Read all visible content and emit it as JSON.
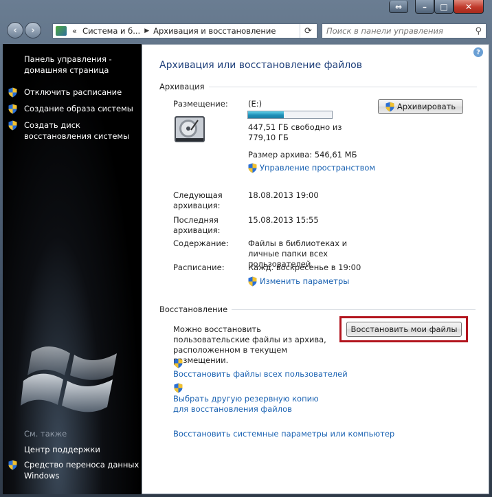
{
  "window": {
    "buttons": {
      "resize": "⇔",
      "minimize": "–",
      "maximize": "□",
      "close": "✕"
    }
  },
  "nav": {
    "back_icon": "back-arrow-icon",
    "forward_icon": "forward-arrow-icon",
    "address": {
      "prefix": "«",
      "seg1": "Система и б...",
      "seg2": "Архивация и восстановление"
    },
    "search_placeholder": "Поиск в панели управления"
  },
  "sidebar": {
    "home": "Панель управления - домашняя страница",
    "tasks": [
      {
        "label": "Отключить расписание"
      },
      {
        "label": "Создание образа системы"
      },
      {
        "label": "Создать диск восстановления системы"
      }
    ],
    "see_also": "См. также",
    "links": [
      {
        "label": "Центр поддержки"
      },
      {
        "label": "Средство переноса данных Windows"
      }
    ]
  },
  "main": {
    "title": "Архивация или восстановление файлов",
    "backup": {
      "header": "Архивация",
      "location_label": "Размещение:",
      "location_value": "(E:)",
      "free_text": "447,51 ГБ свободно из 779,10 ГБ",
      "usage_fraction": 0.43,
      "archive_size": "Размер архива: 546,61 МБ",
      "manage_space": "Управление пространством",
      "backup_button": "Архивировать",
      "next_label": "Следующая архивация:",
      "next_value": "18.08.2013 19:00",
      "last_label": "Последняя архивация:",
      "last_value": "15.08.2013 15:55",
      "contents_label": "Содержание:",
      "contents_value": "Файлы в библиотеках и личные папки всех пользователей",
      "schedule_label": "Расписание:",
      "schedule_value": "Кажд. воскресенье в 19:00",
      "change_settings": "Изменить параметры"
    },
    "restore": {
      "header": "Восстановление",
      "text": "Можно восстановить пользовательские файлы из архива, расположенном в текущем размещении.",
      "restore_button": "Восстановить мои файлы",
      "all_users_link": "Восстановить файлы всех пользователей",
      "other_backup_link": "Выбрать другую резервную копию для восстановления файлов",
      "system_link": "Восстановить системные параметры или компьютер"
    }
  },
  "colors": {
    "link": "#1a62b2",
    "title": "#1e3f7a",
    "highlight": "#b2141d"
  }
}
